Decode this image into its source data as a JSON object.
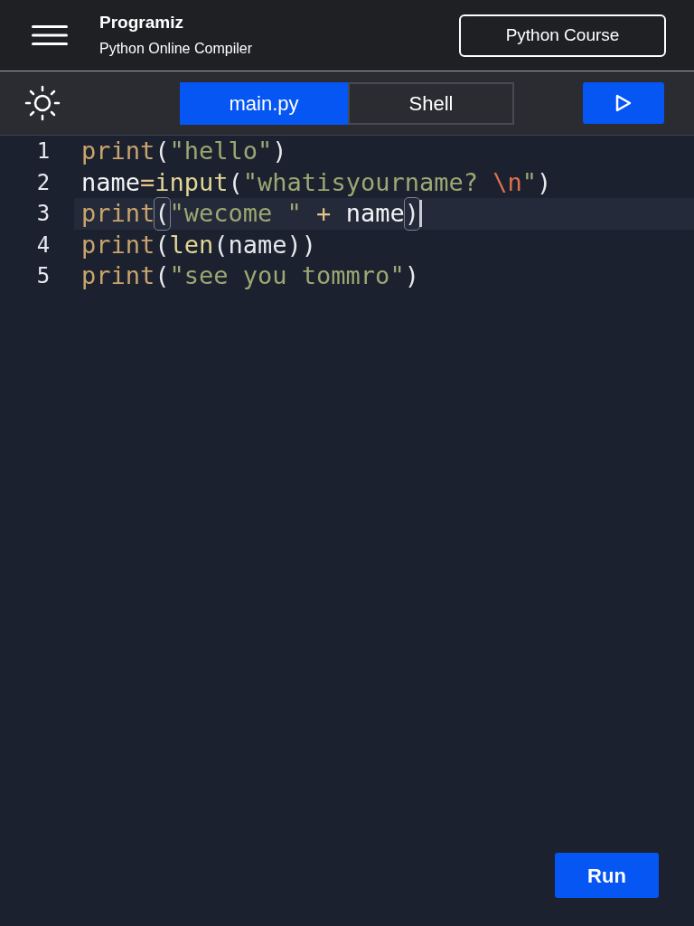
{
  "header": {
    "logo": "Programiz",
    "subtitle": "Python Online Compiler",
    "course_button": "Python Course"
  },
  "tabs": [
    {
      "label": "main.py",
      "selected": true
    },
    {
      "label": "Shell",
      "selected": false
    }
  ],
  "editor": {
    "lines": [
      {
        "number": "1",
        "active": false,
        "tokens": [
          {
            "text": "print",
            "kind": "builtin"
          },
          {
            "text": "(",
            "kind": "punct"
          },
          {
            "text": "\"hello\"",
            "kind": "string"
          },
          {
            "text": ")",
            "kind": "punct"
          }
        ]
      },
      {
        "number": "2",
        "active": false,
        "tokens": [
          {
            "text": "name",
            "kind": "name"
          },
          {
            "text": "=",
            "kind": "op"
          },
          {
            "text": "input",
            "kind": "function"
          },
          {
            "text": "(",
            "kind": "punct"
          },
          {
            "text": "\"whatisyourname? ",
            "kind": "string"
          },
          {
            "text": "\\n",
            "kind": "escape"
          },
          {
            "text": "\"",
            "kind": "string"
          },
          {
            "text": ")",
            "kind": "punct"
          }
        ]
      },
      {
        "number": "3",
        "active": true,
        "tokens": [
          {
            "text": "print",
            "kind": "builtin"
          },
          {
            "text": "(",
            "kind": "bracket_match"
          },
          {
            "text": "\"wecome \"",
            "kind": "string"
          },
          {
            "text": " + ",
            "kind": "op"
          },
          {
            "text": "name",
            "kind": "name"
          },
          {
            "text": ")",
            "kind": "bracket_match"
          }
        ]
      },
      {
        "number": "4",
        "active": false,
        "tokens": [
          {
            "text": "print",
            "kind": "builtin"
          },
          {
            "text": "(",
            "kind": "punct"
          },
          {
            "text": "len",
            "kind": "function"
          },
          {
            "text": "(name))",
            "kind": "punct"
          }
        ]
      },
      {
        "number": "5",
        "active": false,
        "tokens": [
          {
            "text": "print",
            "kind": "builtin"
          },
          {
            "text": "(",
            "kind": "punct"
          },
          {
            "text": "\"see you tommro\"",
            "kind": "string"
          },
          {
            "text": ")",
            "kind": "punct"
          }
        ]
      }
    ]
  },
  "run_button": "Run"
}
